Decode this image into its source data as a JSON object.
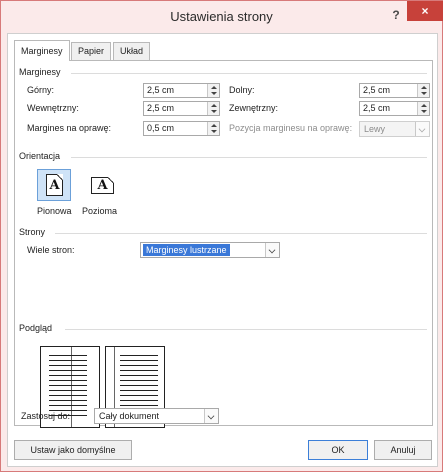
{
  "window": {
    "title": "Ustawienia strony",
    "help_label": "?",
    "close_label": "×",
    "accent_close": "#c7413a"
  },
  "tabs": [
    {
      "label": "Marginesy",
      "active": true
    },
    {
      "label": "Papier",
      "active": false
    },
    {
      "label": "Układ",
      "active": false
    }
  ],
  "margins": {
    "group_label": "Marginesy",
    "top_label": "Górny:",
    "top_value": "2,5 cm",
    "bottom_label": "Dolny:",
    "bottom_value": "2,5 cm",
    "inside_label": "Wewnętrzny:",
    "inside_value": "2,5 cm",
    "outside_label": "Zewnętrzny:",
    "outside_value": "2,5 cm",
    "gutter_label": "Margines na oprawę:",
    "gutter_value": "0,5 cm",
    "gutter_pos_label": "Pozycja marginesu na oprawę:",
    "gutter_pos_value": "Lewy"
  },
  "orientation": {
    "group_label": "Orientacja",
    "portrait_label": "Pionowa",
    "landscape_label": "Pozioma",
    "icon_letter": "A"
  },
  "pages": {
    "group_label": "Strony",
    "multiple_label": "Wiele stron:",
    "multiple_value": "Marginesy lustrzane"
  },
  "preview": {
    "group_label": "Podgląd"
  },
  "apply": {
    "label": "Zastosuj do:",
    "value": "Cały dokument"
  },
  "buttons": {
    "default_label": "Ustaw jako domyślne",
    "ok_label": "OK",
    "cancel_label": "Anuluj"
  }
}
